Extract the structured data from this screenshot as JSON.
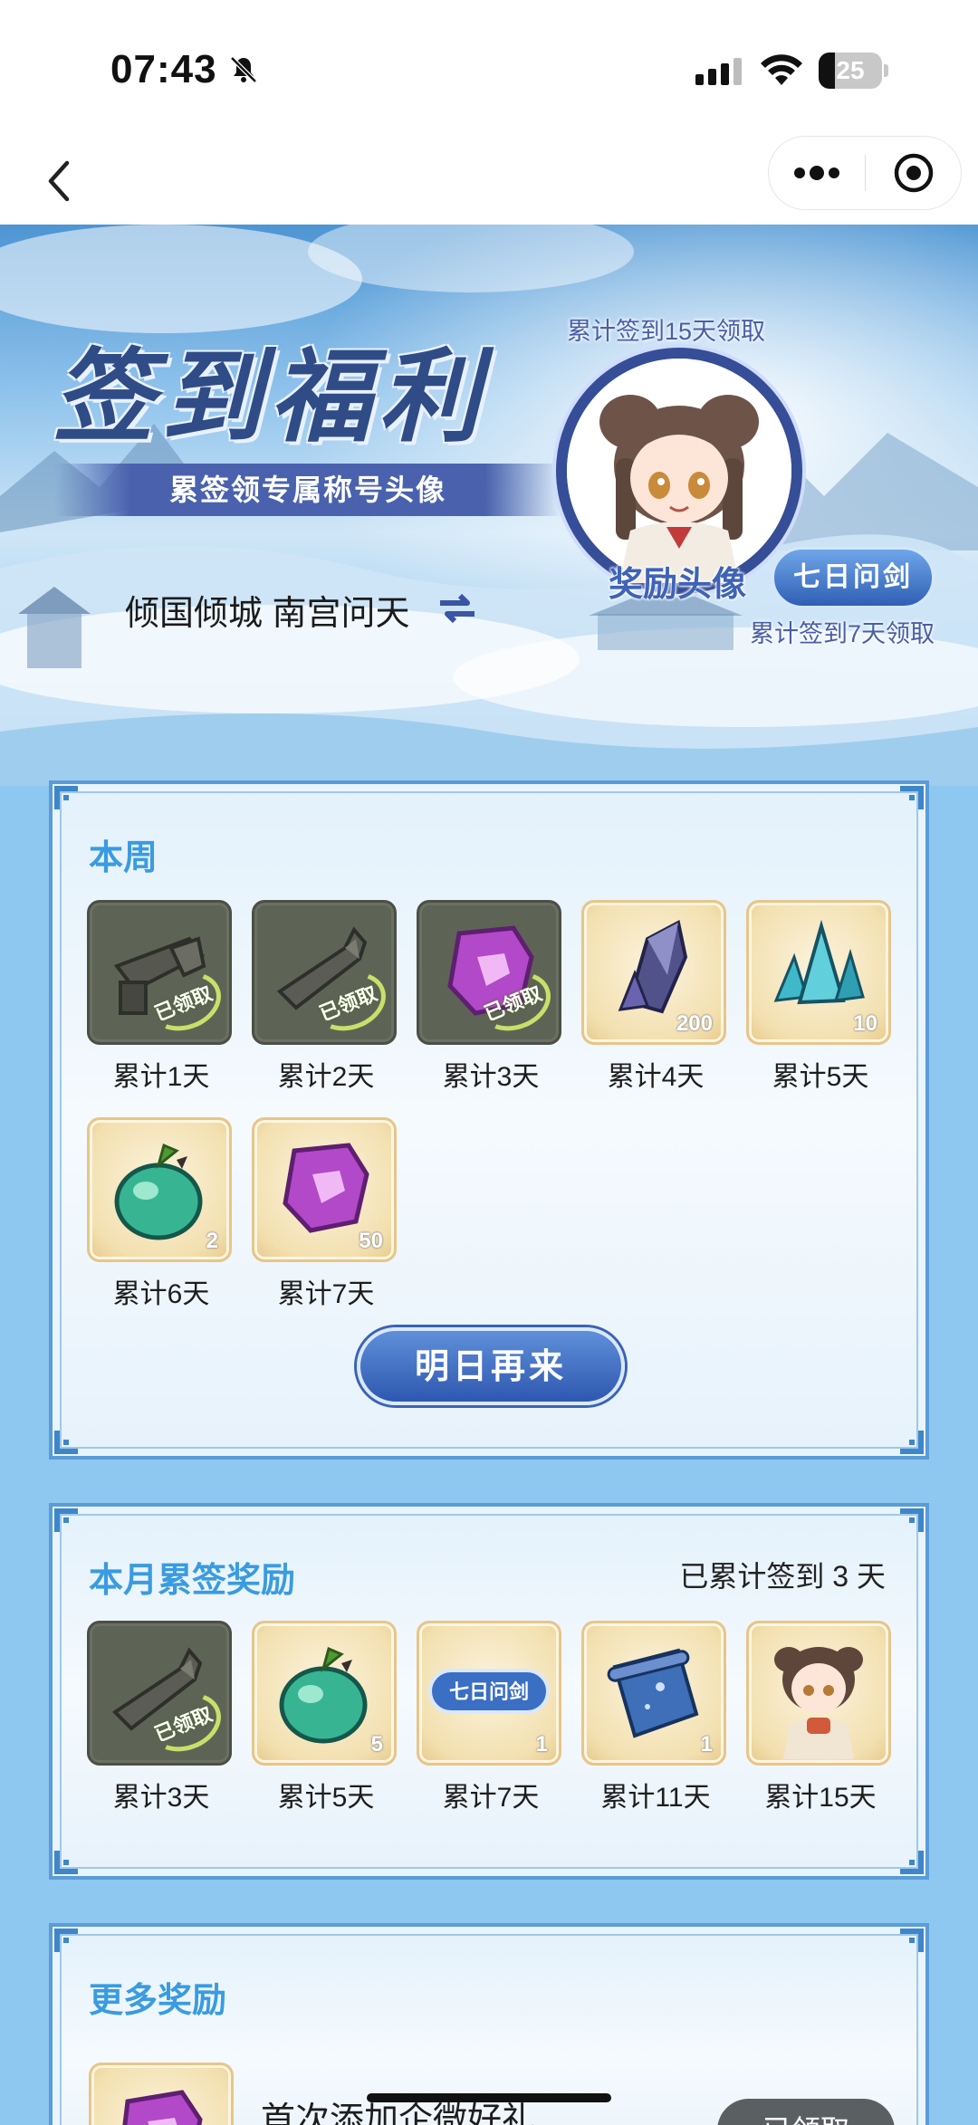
{
  "status_bar": {
    "time": "07:43",
    "battery": "25",
    "battery_level": 0.25
  },
  "hero": {
    "title": "签到福利",
    "subtitle": "累签领专属称号头像",
    "current_title": "倾国倾城 南宫问天",
    "avatar_caption_top": "累计签到15天领取",
    "avatar_label": "奖励头像",
    "badge_label": "七日问剑",
    "badge_caption": "累计签到7天领取"
  },
  "weekly": {
    "title": "本周",
    "claimed_text": "已领取",
    "button": "明日再来",
    "items": [
      {
        "label": "累计1天",
        "icon": "sword-relic-icon",
        "qty": "",
        "claimed": true
      },
      {
        "label": "累计2天",
        "icon": "broken-sword-icon",
        "qty": "",
        "claimed": true
      },
      {
        "label": "累计3天",
        "icon": "purple-token-icon",
        "qty": "",
        "claimed": true
      },
      {
        "label": "累计4天",
        "icon": "crystal-shard-icon",
        "qty": "200",
        "claimed": false
      },
      {
        "label": "累计5天",
        "icon": "blue-crystal-icon",
        "qty": "10",
        "claimed": false
      },
      {
        "label": "累计6天",
        "icon": "jade-fruit-icon",
        "qty": "2",
        "claimed": false
      },
      {
        "label": "累计7天",
        "icon": "purple-token-icon",
        "qty": "50",
        "claimed": false
      }
    ]
  },
  "monthly": {
    "title": "本月累签奖励",
    "meta": "已累计签到 3 天",
    "badge_label": "七日问剑",
    "items": [
      {
        "label": "累计3天",
        "icon": "broken-sword-icon",
        "qty": "",
        "claimed": true
      },
      {
        "label": "累计5天",
        "icon": "jade-fruit-icon",
        "qty": "5",
        "claimed": false
      },
      {
        "label": "累计7天",
        "icon": "title-badge-icon",
        "qty": "1",
        "claimed": false
      },
      {
        "label": "累计11天",
        "icon": "blue-scroll-icon",
        "qty": "1",
        "claimed": false
      },
      {
        "label": "累计15天",
        "icon": "avatar-portrait-icon",
        "qty": "",
        "claimed": false
      }
    ]
  },
  "more": {
    "title": "更多奖励",
    "gift_title": "首次添加企微好礼",
    "gift_button": "已领取"
  },
  "colors": {
    "accent": "#3a9be0",
    "button": "#2e58b0",
    "claimed": "#5e6455"
  }
}
